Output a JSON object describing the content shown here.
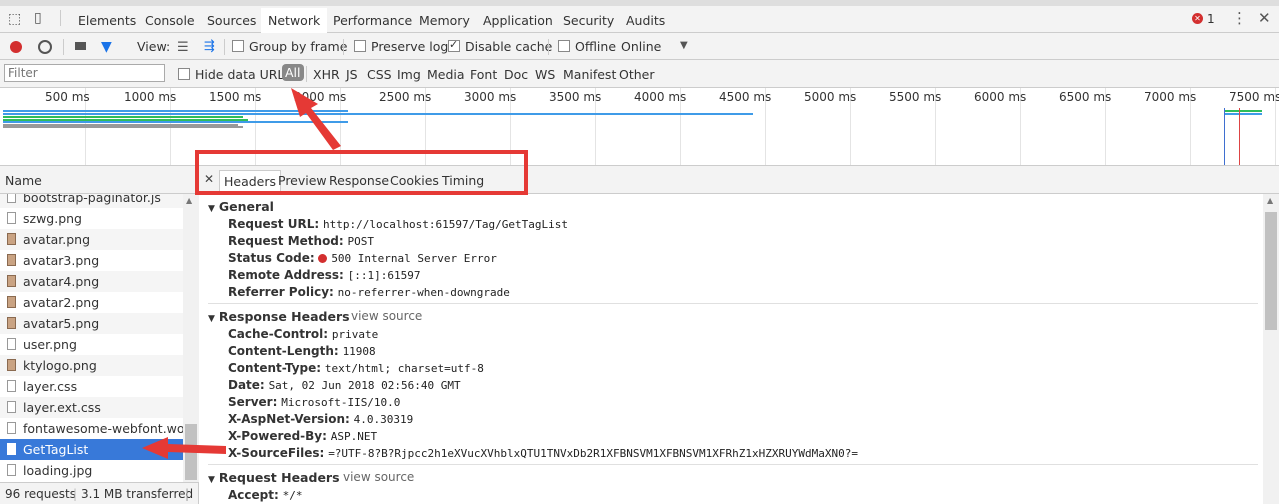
{
  "devtools_tabs": [
    "Elements",
    "Console",
    "Sources",
    "Network",
    "Performance",
    "Memory",
    "Application",
    "Security",
    "Audits"
  ],
  "active_tab": "Network",
  "error_count": "1",
  "toolbar": {
    "view_label": "View:",
    "group_by_frame": "Group by frame",
    "preserve_log": "Preserve log",
    "disable_cache": "Disable cache",
    "offline": "Offline",
    "throttling": "Online"
  },
  "filter": {
    "placeholder": "Filter",
    "hide_data_urls": "Hide data URLs",
    "types": [
      "All",
      "XHR",
      "JS",
      "CSS",
      "Img",
      "Media",
      "Font",
      "Doc",
      "WS",
      "Manifest",
      "Other"
    ]
  },
  "timeline_ticks": [
    "500 ms",
    "1000 ms",
    "1500 ms",
    "2000 ms",
    "2500 ms",
    "3000 ms",
    "3500 ms",
    "4000 ms",
    "4500 ms",
    "5000 ms",
    "5500 ms",
    "6000 ms",
    "6500 ms",
    "7000 ms",
    "7500 ms"
  ],
  "name_header": "Name",
  "files": [
    {
      "name": "bootstrap-paginator.js",
      "type": "doc"
    },
    {
      "name": "szwg.png",
      "type": "doc"
    },
    {
      "name": "avatar.png",
      "type": "img"
    },
    {
      "name": "avatar3.png",
      "type": "img"
    },
    {
      "name": "avatar4.png",
      "type": "img"
    },
    {
      "name": "avatar2.png",
      "type": "img"
    },
    {
      "name": "avatar5.png",
      "type": "img"
    },
    {
      "name": "user.png",
      "type": "doc"
    },
    {
      "name": "ktylogo.png",
      "type": "img"
    },
    {
      "name": "layer.css",
      "type": "doc"
    },
    {
      "name": "layer.ext.css",
      "type": "doc"
    },
    {
      "name": "fontawesome-webfont.woff?v...",
      "type": "doc"
    },
    {
      "name": "GetTagList",
      "type": "doc",
      "selected": true
    },
    {
      "name": "loading.jpg",
      "type": "doc"
    }
  ],
  "status": {
    "requests": "96 requests",
    "transferred": "3.1 MB transferred"
  },
  "detail_tabs": [
    "Headers",
    "Preview",
    "Response",
    "Cookies",
    "Timing"
  ],
  "detail_active": "Headers",
  "general": {
    "title": "General",
    "rows": [
      {
        "k": "Request URL:",
        "v": "http://localhost:61597/Tag/GetTagList"
      },
      {
        "k": "Request Method:",
        "v": "POST"
      },
      {
        "k": "Status Code:",
        "v": "500 Internal Server Error",
        "status_dot": "#d32f2f"
      },
      {
        "k": "Remote Address:",
        "v": "[::1]:61597"
      },
      {
        "k": "Referrer Policy:",
        "v": "no-referrer-when-downgrade"
      }
    ]
  },
  "response_headers": {
    "title": "Response Headers",
    "view_source": "view source",
    "rows": [
      {
        "k": "Cache-Control:",
        "v": "private"
      },
      {
        "k": "Content-Length:",
        "v": "11908"
      },
      {
        "k": "Content-Type:",
        "v": "text/html; charset=utf-8"
      },
      {
        "k": "Date:",
        "v": "Sat, 02 Jun 2018 02:56:40 GMT"
      },
      {
        "k": "Server:",
        "v": "Microsoft-IIS/10.0"
      },
      {
        "k": "X-AspNet-Version:",
        "v": "4.0.30319"
      },
      {
        "k": "X-Powered-By:",
        "v": "ASP.NET"
      },
      {
        "k": "X-SourceFiles:",
        "v": "=?UTF-8?B?Rjpcc2h1eXVucXVhblxQTU1TNVxDb2R1XFBNSVM1XFBNSVM1XFRhZ1xHZXRUYWdMaXN0?="
      }
    ]
  },
  "request_headers": {
    "title": "Request Headers",
    "view_source": "view source",
    "rows": [
      {
        "k": "Accept:",
        "v": "*/*"
      }
    ]
  },
  "colors": {
    "accent": "#1a73e8",
    "selected_row": "#3879d9",
    "annotation": "#e53935",
    "record": "#d32f2f"
  }
}
